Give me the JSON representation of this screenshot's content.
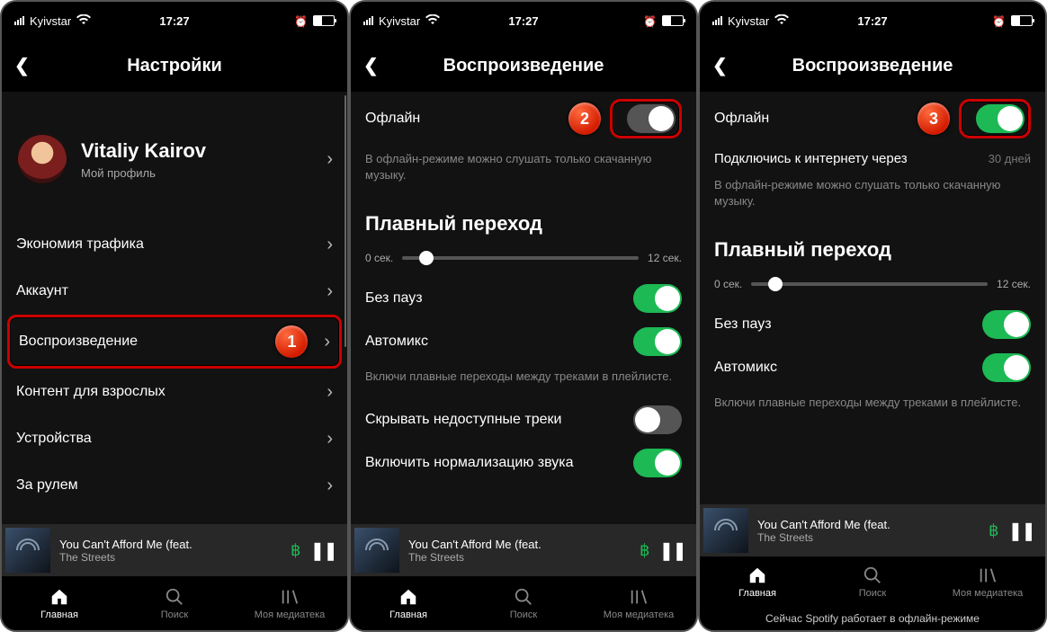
{
  "status": {
    "carrier": "Kyivstar",
    "time": "17:27"
  },
  "screen1": {
    "title": "Настройки",
    "profile": {
      "name": "Vitaliy Kairov",
      "sub": "Мой профиль"
    },
    "items": [
      "Экономия трафика",
      "Аккаунт",
      "Воспроизведение",
      "Контент для взрослых",
      "Устройства",
      "За рулем"
    ],
    "callout": "1"
  },
  "screen2": {
    "title": "Воспроизведение",
    "offline_label": "Офлайн",
    "offline_hint": "В офлайн-режиме можно слушать только скачанную музыку.",
    "section_crossfade": "Плавный переход",
    "slider_min": "0 сек.",
    "slider_max": "12 сек.",
    "gapless": "Без пауз",
    "automix": "Автомикс",
    "automix_hint": "Включи плавные переходы между треками в плейлисте.",
    "hide_unavail": "Скрывать недоступные треки",
    "normalize": "Включить нормализацию звука",
    "callout": "2"
  },
  "screen3": {
    "title": "Воспроизведение",
    "offline_label": "Офлайн",
    "connect_label": "Подключись к интернету через",
    "connect_days": "30 дней",
    "offline_hint": "В офлайн-режиме можно слушать только скачанную музыку.",
    "section_crossfade": "Плавный переход",
    "slider_min": "0 сек.",
    "slider_max": "12 сек.",
    "gapless": "Без пауз",
    "automix": "Автомикс",
    "automix_hint": "Включи плавные переходы между треками в плейлисте.",
    "callout": "3",
    "offline_bar": "Сейчас Spotify работает в офлайн-режиме"
  },
  "player": {
    "title": "You Can't Afford Me (feat.",
    "artist": "The Streets"
  },
  "tabs": {
    "home": "Главная",
    "search": "Поиск",
    "library": "Моя медиатека"
  }
}
